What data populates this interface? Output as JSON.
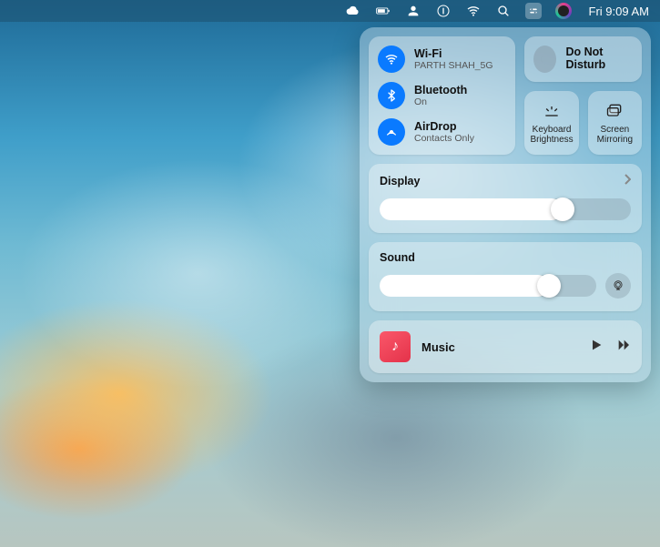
{
  "menubar": {
    "time_label": "Fri 9:09 AM",
    "icons": {
      "cloud": "cloud-icon",
      "battery": "battery-icon",
      "user": "user-icon",
      "onepassword": "password-manager-icon",
      "wifi": "wifi-icon",
      "search": "spotlight-icon",
      "control_center": "control-center-icon",
      "siri": "siri-icon"
    }
  },
  "control_center": {
    "connectivity": {
      "wifi": {
        "title": "Wi-Fi",
        "subtitle": "PARTH SHAH_5G",
        "enabled": true
      },
      "bluetooth": {
        "title": "Bluetooth",
        "subtitle": "On",
        "enabled": true
      },
      "airdrop": {
        "title": "AirDrop",
        "subtitle": "Contacts Only",
        "enabled": true
      }
    },
    "dnd": {
      "title": "Do Not Disturb",
      "enabled": false
    },
    "keyboard_brightness": {
      "label": "Keyboard Brightness"
    },
    "screen_mirroring": {
      "label": "Screen Mirroring"
    },
    "display": {
      "title": "Display",
      "value_pct": 73
    },
    "sound": {
      "title": "Sound",
      "value_pct": 78
    },
    "now_playing": {
      "app": "Music"
    }
  }
}
